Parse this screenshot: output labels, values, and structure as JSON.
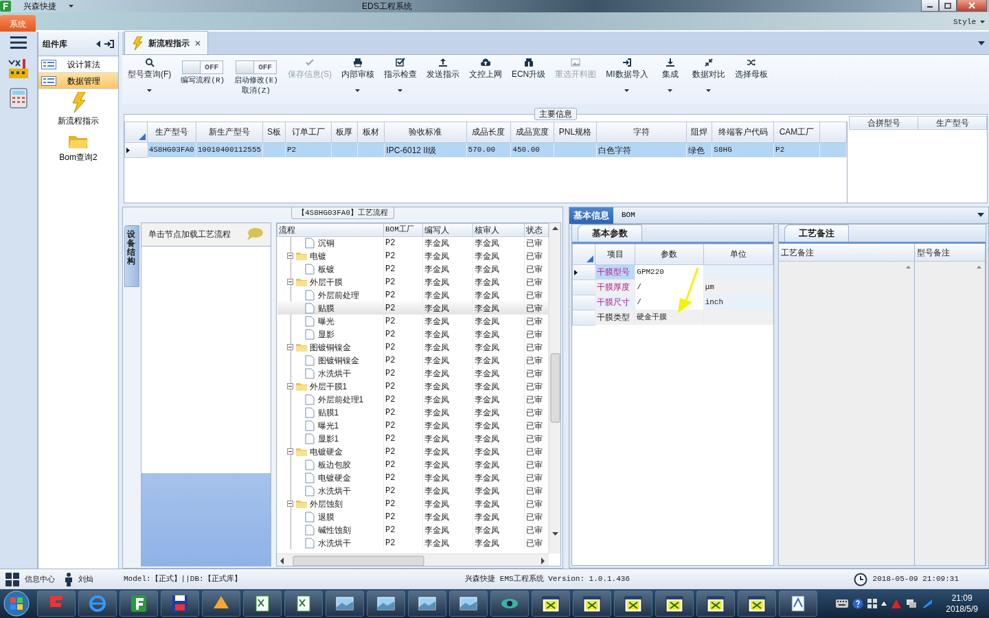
{
  "window": {
    "app_name": "兴森快捷",
    "title": "EDS工程系统"
  },
  "ribbon": {
    "tabs": [
      {
        "label": "系统",
        "selected": true
      }
    ],
    "style_menu": "Style"
  },
  "component_panel": {
    "title": "组件库",
    "items": [
      {
        "label": "设计算法",
        "selected": false
      },
      {
        "label": "数据管理",
        "selected": true
      }
    ],
    "shortcuts": [
      {
        "label": "新流程指示",
        "kind": "lightning"
      },
      {
        "label": "Bom查询2",
        "kind": "folder"
      }
    ]
  },
  "doc_tabs": [
    {
      "label": "新流程指示",
      "selected": true
    }
  ],
  "toolbar": [
    {
      "kind": "button",
      "label": "型号查询(F)",
      "dropdown": true,
      "disabled": false
    },
    {
      "kind": "toggle",
      "label": "编写流程(R)",
      "switch_text": "OFF",
      "on": false
    },
    {
      "kind": "toggle",
      "label": "启动修改(E)",
      "sublabel": "取消(Z)",
      "switch_text": "OFF",
      "on": false
    },
    {
      "kind": "button",
      "label": "保存信息(S)",
      "dropdown": false,
      "disabled": true
    },
    {
      "kind": "button",
      "label": "内部审核",
      "dropdown": true,
      "disabled": false
    },
    {
      "kind": "button",
      "label": "指示检查",
      "dropdown": true,
      "disabled": false
    },
    {
      "kind": "button",
      "label": "发送指示",
      "dropdown": false,
      "disabled": false
    },
    {
      "kind": "button",
      "label": "文控上网",
      "dropdown": false,
      "disabled": false
    },
    {
      "kind": "button",
      "label": "ECN升级",
      "dropdown": false,
      "disabled": false
    },
    {
      "kind": "button",
      "label": "重选开料图",
      "dropdown": false,
      "disabled": true
    },
    {
      "kind": "button",
      "label": "MI数据导入",
      "dropdown": true,
      "disabled": false
    },
    {
      "kind": "button",
      "label": "集成",
      "dropdown": true,
      "disabled": false
    },
    {
      "kind": "button",
      "label": "数据对比",
      "dropdown": true,
      "disabled": false
    },
    {
      "kind": "button",
      "label": "选择母板",
      "dropdown": false,
      "disabled": false
    }
  ],
  "main_info": {
    "title": "主要信息",
    "columns": [
      "生产型号",
      "新生产型号",
      "S板",
      "订单工厂",
      "板厚",
      "板材",
      "验收标准",
      "成品长度",
      "成品宽度",
      "PNL规格",
      "字符",
      "阻焊",
      "终端客户代码",
      "CAM工厂"
    ],
    "rows": [
      {
        "selected": true,
        "cells": [
          "4S8HG03FA0",
          "10010400112555",
          null,
          "P2",
          null,
          null,
          "IPC-6012 II级",
          "570.00",
          "450.00",
          null,
          "白色字符",
          "绿色",
          "S8HG",
          "P2"
        ]
      }
    ],
    "merge_columns": [
      "合拼型号",
      "生产型号"
    ]
  },
  "process": {
    "title": "【4S8HG03FA0】工艺流程",
    "side_tab": "设备结构",
    "hint": "单击节点加载工艺流程",
    "columns": [
      "流程",
      "BOM工厂",
      "编写人",
      "核审人",
      "状态"
    ],
    "nodes": [
      {
        "children": [
          {
            "label": "沉铜",
            "bom": "P2",
            "author": "李金凤",
            "reviewer": "李金凤",
            "status": "已审",
            "selected": false
          }
        ]
      },
      {
        "label": "电镀",
        "bom": "P2",
        "author": "李金凤",
        "reviewer": "李金凤",
        "status": "已审",
        "selected": false,
        "expanded": true,
        "children": [
          {
            "label": "板镀",
            "bom": "P2",
            "author": "李金凤",
            "reviewer": "李金凤",
            "status": "已审",
            "selected": false
          }
        ]
      },
      {
        "label": "外层干膜",
        "bom": "P2",
        "author": "李金凤",
        "reviewer": "李金凤",
        "status": "已审",
        "selected": false,
        "expanded": true,
        "children": [
          {
            "label": "外层前处理",
            "bom": "P2",
            "author": "李金凤",
            "reviewer": "李金凤",
            "status": "已审",
            "selected": false
          },
          {
            "label": "贴膜",
            "bom": "P2",
            "author": "李金凤",
            "reviewer": "李金凤",
            "status": "已审",
            "selected": true
          },
          {
            "label": "曝光",
            "bom": "P2",
            "author": "李金凤",
            "reviewer": "李金凤",
            "status": "已审",
            "selected": false
          },
          {
            "label": "显影",
            "bom": "P2",
            "author": "李金凤",
            "reviewer": "李金凤",
            "status": "已审",
            "selected": false
          }
        ]
      },
      {
        "label": "图镀铜镍金",
        "bom": "P2",
        "author": "李金凤",
        "reviewer": "李金凤",
        "status": "已审",
        "selected": false,
        "expanded": true,
        "children": [
          {
            "label": "图镀铜镍金",
            "bom": "P2",
            "author": "李金凤",
            "reviewer": "李金凤",
            "status": "已审",
            "selected": false
          },
          {
            "label": "水洗烘干",
            "bom": "P2",
            "author": "李金凤",
            "reviewer": "李金凤",
            "status": "已审",
            "selected": false
          }
        ]
      },
      {
        "label": "外层干膜1",
        "bom": "P2",
        "author": "李金凤",
        "reviewer": "李金凤",
        "status": "已审",
        "selected": false,
        "expanded": true,
        "children": [
          {
            "label": "外层前处理1",
            "bom": "P2",
            "author": "李金凤",
            "reviewer": "李金凤",
            "status": "已审",
            "selected": false
          },
          {
            "label": "贴膜1",
            "bom": "P2",
            "author": "李金凤",
            "reviewer": "李金凤",
            "status": "已审",
            "selected": false
          },
          {
            "label": "曝光1",
            "bom": "P2",
            "author": "李金凤",
            "reviewer": "李金凤",
            "status": "已审",
            "selected": false
          },
          {
            "label": "显影1",
            "bom": "P2",
            "author": "李金凤",
            "reviewer": "李金凤",
            "status": "已审",
            "selected": false
          }
        ]
      },
      {
        "label": "电镀硬金",
        "bom": "P2",
        "author": "李金凤",
        "reviewer": "李金凤",
        "status": "已审",
        "selected": false,
        "expanded": true,
        "children": [
          {
            "label": "板边包胶",
            "bom": "P2",
            "author": "李金凤",
            "reviewer": "李金凤",
            "status": "已审",
            "selected": false
          },
          {
            "label": "电镀硬金",
            "bom": "P2",
            "author": "李金凤",
            "reviewer": "李金凤",
            "status": "已审",
            "selected": false
          },
          {
            "label": "水洗烘干",
            "bom": "P2",
            "author": "李金凤",
            "reviewer": "李金凤",
            "status": "已审",
            "selected": false
          }
        ]
      },
      {
        "label": "外层蚀刻",
        "bom": "P2",
        "author": "李金凤",
        "reviewer": "李金凤",
        "status": "已审",
        "selected": false,
        "expanded": true,
        "children": [
          {
            "label": "退膜",
            "bom": "P2",
            "author": "李金凤",
            "reviewer": "李金凤",
            "status": "已审",
            "selected": false
          },
          {
            "label": "碱性蚀刻",
            "bom": "P2",
            "author": "李金凤",
            "reviewer": "李金凤",
            "status": "已审",
            "selected": false
          },
          {
            "label": "水洗烘干",
            "bom": "P2",
            "author": "李金凤",
            "reviewer": "李金凤",
            "status": "已审",
            "selected": false
          }
        ]
      }
    ]
  },
  "detail": {
    "tabs": [
      {
        "label": "基本信息",
        "selected": true
      },
      {
        "label": "BOM",
        "selected": false
      }
    ],
    "params": {
      "tab": "基本参数",
      "columns": [
        "项目",
        "参数",
        "单位"
      ],
      "rows": [
        {
          "item": "干膜型号",
          "value": "GPM220",
          "required": true,
          "selected": true
        },
        {
          "item": "干膜厚度",
          "value": "/",
          "unit": "μm",
          "required": true,
          "selected": false
        },
        {
          "item": "干膜尺寸",
          "value": "/",
          "unit": "inch",
          "required": true,
          "selected": false
        },
        {
          "item": "干膜类型",
          "value": "硬金干膜",
          "required": false,
          "selected": false
        }
      ]
    },
    "notes": {
      "tab": "工艺备注",
      "columns": [
        "工艺备注",
        "型号备注"
      ]
    }
  },
  "status_bar": {
    "center": "信息中心",
    "user": "刘灿",
    "model": "Model:【正式】||DB:【正式库】",
    "version": "兴森快捷 EMS工程系统 Version: 1.0.1.436",
    "datetime": "2018-05-09 21:09:31"
  },
  "taskbar": {
    "time": "21:09",
    "date": "2018/5/9"
  }
}
